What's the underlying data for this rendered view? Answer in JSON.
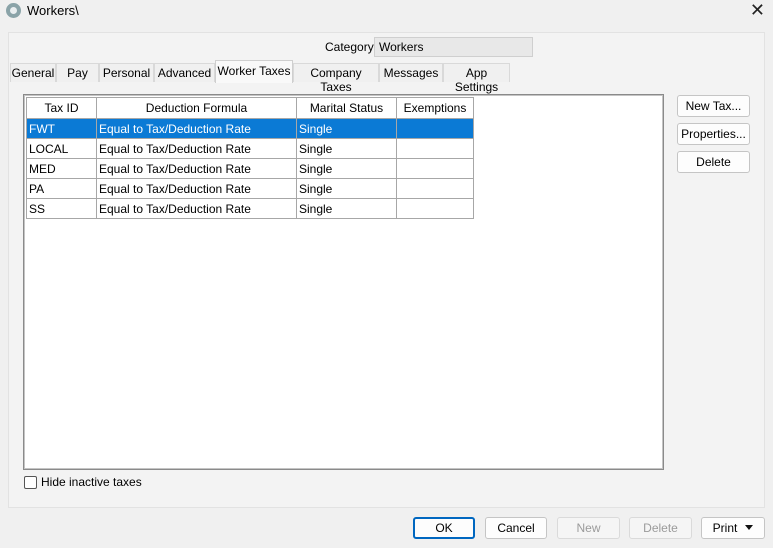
{
  "window": {
    "title": "Workers\\",
    "close_icon": "close-icon"
  },
  "category": {
    "label": "Category:",
    "value": "Workers"
  },
  "tabs": [
    {
      "label": "General"
    },
    {
      "label": "Pay"
    },
    {
      "label": "Personal"
    },
    {
      "label": "Advanced"
    },
    {
      "label": "Worker Taxes",
      "active": true
    },
    {
      "label": "Company Taxes"
    },
    {
      "label": "Messages"
    },
    {
      "label": "App Settings"
    }
  ],
  "table": {
    "columns": [
      "Tax ID",
      "Deduction Formula",
      "Marital Status",
      "Exemptions"
    ],
    "rows": [
      [
        "FWT",
        "Equal to Tax/Deduction Rate",
        "Single",
        ""
      ],
      [
        "LOCAL",
        "Equal to Tax/Deduction Rate",
        "Single",
        ""
      ],
      [
        "MED",
        "Equal to Tax/Deduction Rate",
        "Single",
        ""
      ],
      [
        "PA",
        "Equal to Tax/Deduction Rate",
        "Single",
        ""
      ],
      [
        "SS",
        "Equal to Tax/Deduction Rate",
        "Single",
        ""
      ]
    ],
    "selected_row": 0,
    "selection_color": "#0b7ad5"
  },
  "side_buttons": {
    "new_tax": "New Tax...",
    "properties": "Properties...",
    "delete": "Delete"
  },
  "hide_inactive": {
    "label": "Hide inactive taxes",
    "checked": false
  },
  "bottom_buttons": {
    "ok": "OK",
    "cancel": "Cancel",
    "new": "New",
    "delete": "Delete",
    "print": "Print"
  },
  "colors": {
    "accent": "#0067c0"
  }
}
